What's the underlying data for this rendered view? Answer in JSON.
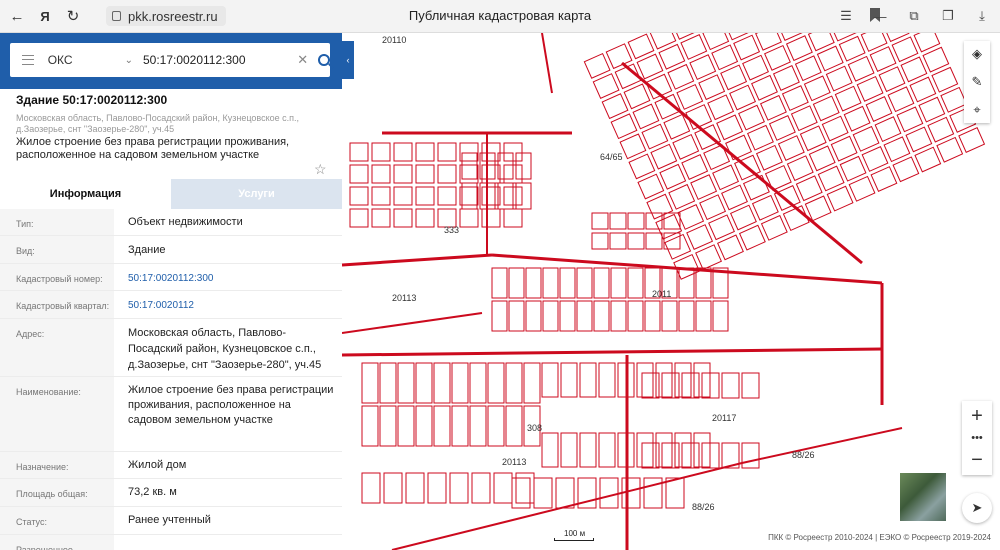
{
  "browser": {
    "url": "pkk.rosreestr.ru",
    "title": "Публичная кадастровая карта",
    "yandex_label": "Я"
  },
  "search": {
    "type": "ОКС",
    "value": "50:17:0020112:300"
  },
  "object": {
    "title": "Здание 50:17:0020112:300",
    "address_small": "Московская область, Павлово-Посадский район, Кузнецовское с.п., д.Заозерье, снт \"Заозерье-280\", уч.45",
    "description": "Жилое строение без права регистрации проживания, расположенное на садовом земельном участке"
  },
  "tabs": {
    "info": "Информация",
    "services": "Услуги"
  },
  "fields": [
    {
      "key": "Тип:",
      "value": "Объект недвижимости"
    },
    {
      "key": "Вид:",
      "value": "Здание"
    },
    {
      "key": "Кадастровый номер:",
      "value": "50:17:0020112:300"
    },
    {
      "key": "Кадастровый квартал:",
      "value": "50:17:0020112"
    },
    {
      "key": "Адрес:",
      "value": "Московская область, Павлово-Посадский район, Кузнецовское с.п., д.Заозерье, снт \"Заозерье-280\", уч.45"
    },
    {
      "key": "Наименование:",
      "value": "Жилое строение без права регистрации проживания, расположенное на садовом земельном участке"
    },
    {
      "key": "Назначение:",
      "value": "Жилой дом"
    },
    {
      "key": "Площадь общая:",
      "value": "73,2 кв. м"
    },
    {
      "key": "Статус:",
      "value": "Ранее учтенный"
    },
    {
      "key": "Разрешенное...",
      "value": ""
    }
  ],
  "map": {
    "scale": "100 м",
    "copyright": "ПКК © Росреестр 2010-2024 | ЕЭКО © Росреестр 2019-2024",
    "labels": [
      "20113",
      "2011",
      "20117",
      "20113",
      "20110",
      "88/26",
      "88/26",
      "308",
      "333",
      "64/65"
    ]
  },
  "colors": {
    "header_blue": "#1f5eaa",
    "parcel_red": "#cc0a1e"
  }
}
